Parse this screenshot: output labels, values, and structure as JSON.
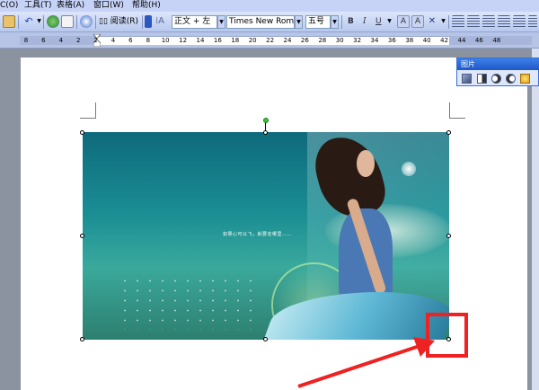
{
  "menu": {
    "items": [
      "C(O)",
      "工具(T)",
      "表格(A)",
      "窗口(W)",
      "帮助(H)"
    ]
  },
  "toolbar": {
    "read_label": "阅读(R)",
    "style_value": "正文 + 左",
    "font_value": "Times New Roman",
    "size_value": "五号",
    "bold_label": "B",
    "italic_label": "I",
    "underline_label": "U",
    "font_color_label": "A"
  },
  "ruler": {
    "ticks": [
      "8",
      "6",
      "4",
      "2",
      "2",
      "4",
      "6",
      "8",
      "10",
      "12",
      "14",
      "16",
      "18",
      "20",
      "22",
      "24",
      "26",
      "28",
      "30",
      "32",
      "34",
      "36",
      "38",
      "40",
      "42",
      "44",
      "46",
      "48"
    ]
  },
  "picture_toolbar": {
    "title": "图片"
  },
  "picture": {
    "slogan": "如果心可以飞，就要去哪里……"
  },
  "annotation": {
    "box_color": "#ee2222",
    "arrow_color": "#ee2222"
  }
}
